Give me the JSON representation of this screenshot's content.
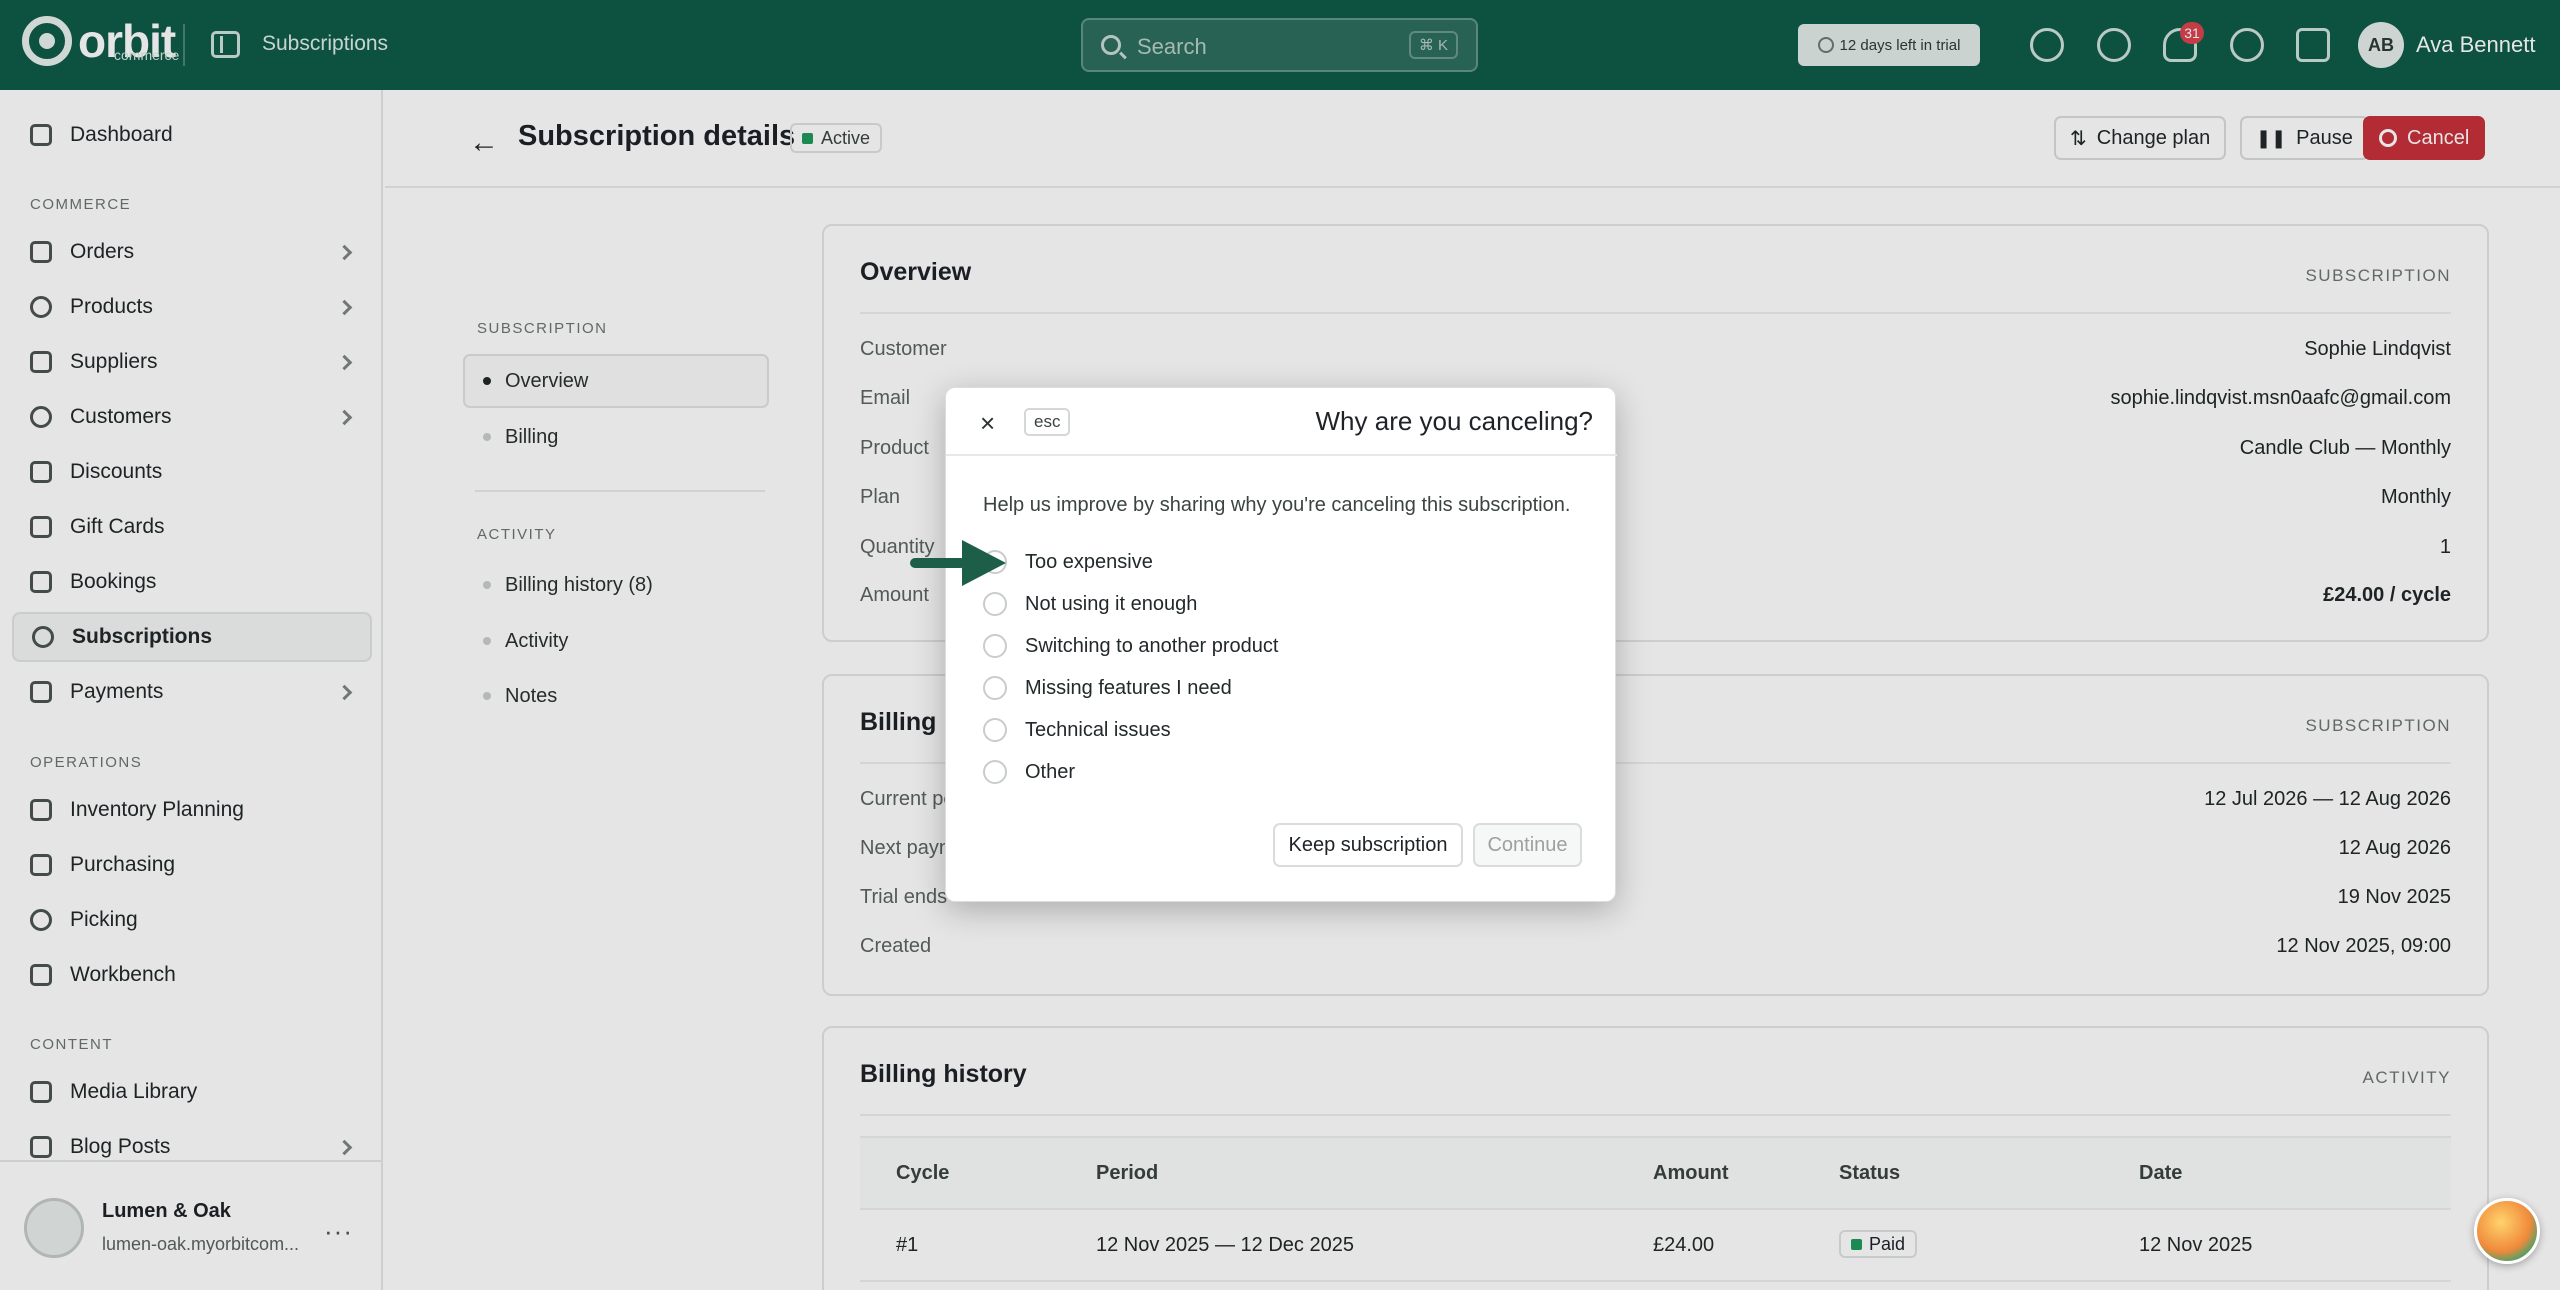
{
  "topbar": {
    "brand": "orbit",
    "brand_sub": "commerce",
    "title": "Subscriptions",
    "search_placeholder": "Search",
    "search_shortcut": "⌘ K",
    "trial_text": "12 days left in trial",
    "notifications_count": "31",
    "user_initials": "AB",
    "user_name": "Ava Bennett"
  },
  "sidebar": {
    "dashboard": "Dashboard",
    "commerce_header": "COMMERCE",
    "commerce_items": [
      "Orders",
      "Products",
      "Suppliers",
      "Customers",
      "Discounts",
      "Gift Cards",
      "Bookings",
      "Subscriptions",
      "Payments"
    ],
    "operations_header": "OPERATIONS",
    "operations_items": [
      "Inventory Planning",
      "Purchasing",
      "Picking",
      "Workbench"
    ],
    "content_header": "CONTENT",
    "content_items": [
      "Media Library",
      "Blog Posts"
    ],
    "store_name": "Lumen & Oak",
    "store_url": "lumen-oak.myorbitcom...",
    "more": "···"
  },
  "page": {
    "title": "Subscription details",
    "status": "Active",
    "actions": {
      "change_plan": "Change plan",
      "pause": "Pause",
      "cancel": "Cancel"
    }
  },
  "subnav": {
    "subscription_header": "SUBSCRIPTION",
    "subscription_items": [
      "Overview",
      "Billing"
    ],
    "activity_header": "ACTIVITY",
    "activity_items": [
      "Billing history (8)",
      "Activity",
      "Notes"
    ]
  },
  "overview": {
    "title": "Overview",
    "tag": "SUBSCRIPTION",
    "rows": [
      {
        "label": "Customer",
        "value": "Sophie Lindqvist"
      },
      {
        "label": "Email",
        "value": "sophie.lindqvist.msn0aafc@gmail.com"
      },
      {
        "label": "Product",
        "value": "Candle Club — Monthly"
      },
      {
        "label": "Plan",
        "value": "Monthly"
      },
      {
        "label": "Quantity",
        "value": "1"
      },
      {
        "label": "Amount",
        "value": "£24.00 / cycle"
      }
    ]
  },
  "billing": {
    "title": "Billing",
    "tag": "SUBSCRIPTION",
    "rows": [
      {
        "label": "Current pe",
        "value": "12 Jul 2026 — 12 Aug 2026"
      },
      {
        "label": "Next payn",
        "value": "12 Aug 2026"
      },
      {
        "label": "Trial ends",
        "value": "19 Nov 2025"
      },
      {
        "label": "Created",
        "value": "12 Nov 2025, 09:00"
      }
    ]
  },
  "billing_history": {
    "title": "Billing history",
    "tag": "ACTIVITY",
    "columns": [
      "Cycle",
      "Period",
      "Amount",
      "Status",
      "Date"
    ],
    "rows": [
      {
        "cycle": "#1",
        "period": "12 Nov 2025 — 12 Dec 2025",
        "amount": "£24.00",
        "status": "Paid",
        "date": "12 Nov 2025"
      }
    ]
  },
  "modal": {
    "close": "×",
    "esc": "esc",
    "title": "Why are you canceling?",
    "description": "Help us improve by sharing why you're canceling this subscription.",
    "options": [
      "Too expensive",
      "Not using it enough",
      "Switching to another product",
      "Missing features I need",
      "Technical issues",
      "Other"
    ],
    "keep_label": "Keep subscription",
    "continue_label": "Continue"
  },
  "colors": {
    "brand": "#0f5b48",
    "danger": "#c8303c",
    "status_green": "#1f9a5c",
    "arrow": "#1d5e48"
  }
}
